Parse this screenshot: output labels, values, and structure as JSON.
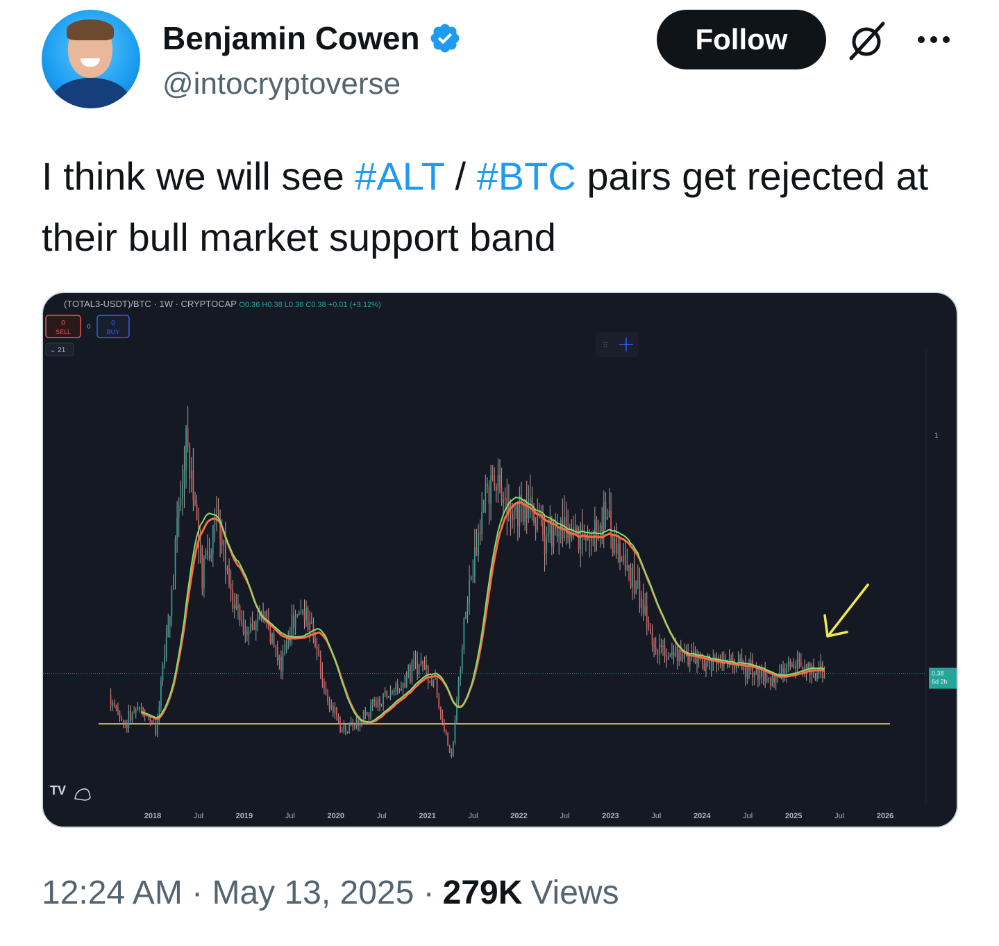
{
  "author": {
    "name": "Benjamin Cowen",
    "handle": "@intocryptoverse"
  },
  "actions": {
    "follow_label": "Follow"
  },
  "tweet": {
    "text_1": "I think we will see ",
    "hashtag_1": "#ALT",
    "text_2": " / ",
    "hashtag_2": "#BTC",
    "text_3": " pairs get rejected at their bull market support band"
  },
  "chart": {
    "symbol": "(TOTAL3-USDT)/BTC",
    "interval": "1W",
    "exchange": "CRYPTOCAP",
    "ohlc": "O0.36 H0.38 L0.36 C0.38 +0.01 (+3.12%)",
    "sell_value": "0",
    "sell_label": "SELL",
    "spread": "0",
    "buy_value": "0",
    "buy_label": "BUY",
    "indicator_count": "21",
    "y_tick_label": "1",
    "price_tag_value": "0.38",
    "price_tag_countdown": "6d 2h",
    "logo_text": "TV",
    "x_labels": [
      "2018",
      "Jul",
      "2019",
      "Jul",
      "2020",
      "Jul",
      "2021",
      "Jul",
      "2022",
      "Jul",
      "2023",
      "Jul",
      "2024",
      "Jul",
      "2025",
      "Jul",
      "2026"
    ],
    "colors": {
      "background": "#151924",
      "price_up": "#26a69a",
      "price_down": "#ef5350",
      "band_fast": "#7ee07a",
      "band_slow": "#ff6b3d",
      "support_line": "#d4c24a",
      "arrow": "#f2e94e",
      "price_tag": "#26a69a"
    }
  },
  "chart_data": {
    "type": "line",
    "title": "(TOTAL3-USDT)/BTC · 1W · CRYPTOCAP",
    "xlabel": "",
    "ylabel": "",
    "grid": false,
    "x": [
      "2017-10",
      "2017-12",
      "2018-01",
      "2018-03",
      "2018-05",
      "2018-07",
      "2018-09",
      "2018-11",
      "2019-01",
      "2019-03",
      "2019-05",
      "2019-07",
      "2019-09",
      "2019-11",
      "2020-01",
      "2020-03",
      "2020-05",
      "2020-07",
      "2020-09",
      "2020-11",
      "2021-01",
      "2021-03",
      "2021-05",
      "2021-07",
      "2021-09",
      "2021-11",
      "2022-01",
      "2022-03",
      "2022-05",
      "2022-07",
      "2022-09",
      "2022-11",
      "2023-01",
      "2023-03",
      "2023-05",
      "2023-07",
      "2023-09",
      "2023-11",
      "2024-01",
      "2024-03",
      "2024-05",
      "2024-07",
      "2024-09",
      "2024-11",
      "2025-01",
      "2025-03",
      "2025-05"
    ],
    "series": [
      {
        "name": "",
        "values": [
          0.31,
          0.22,
          0.28,
          0.2,
          0.62,
          1.15,
          0.7,
          0.9,
          0.6,
          0.52,
          0.55,
          0.4,
          0.58,
          0.55,
          0.3,
          0.2,
          0.22,
          0.28,
          0.32,
          0.36,
          0.42,
          0.35,
          0.1,
          0.62,
          0.9,
          1.0,
          0.88,
          0.95,
          0.8,
          0.84,
          0.8,
          0.85,
          0.88,
          0.72,
          0.65,
          0.47,
          0.45,
          0.44,
          0.42,
          0.41,
          0.41,
          0.4,
          0.38,
          0.36,
          0.42,
          0.39,
          0.38
        ]
      }
    ],
    "horizontal_lines": [
      0.22
    ]
  }
}
